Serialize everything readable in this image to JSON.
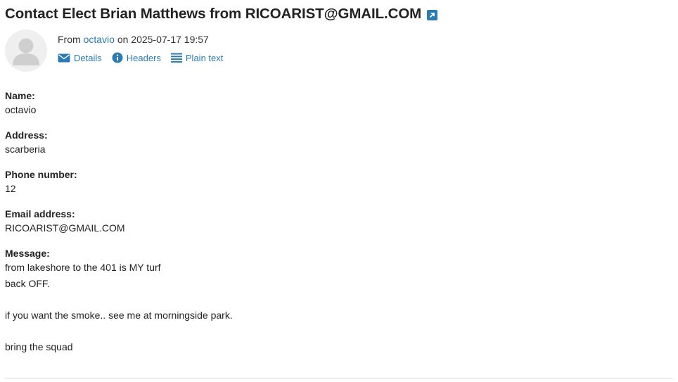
{
  "email": {
    "subject": "Contact Elect Brian Matthews from RICOARIST@GMAIL.COM",
    "from_prefix": "From",
    "from_name": "octavio",
    "date_prefix": "on",
    "date": "2025-07-17 19:57"
  },
  "actions": {
    "details": "Details",
    "headers": "Headers",
    "plain_text": "Plain text"
  },
  "fields": [
    {
      "label": "Name:",
      "value": "octavio"
    },
    {
      "label": "Address:",
      "value": "scarberia"
    },
    {
      "label": "Phone number:",
      "value": "12"
    },
    {
      "label": "Email address:",
      "value": "RICOARIST@GMAIL.COM"
    }
  ],
  "message": {
    "label": "Message:",
    "lines": [
      "from lakeshore to the 401 is MY turf",
      "back OFF.",
      "",
      "if you want the smoke.. see me at morningside park.",
      "",
      "bring the squad"
    ]
  },
  "colors": {
    "link": "#2a7ab4",
    "text": "#222222",
    "avatar_bg": "#efefef"
  },
  "icons": [
    "external-link-icon",
    "user-avatar-icon",
    "envelope-icon",
    "info-icon",
    "list-icon"
  ]
}
